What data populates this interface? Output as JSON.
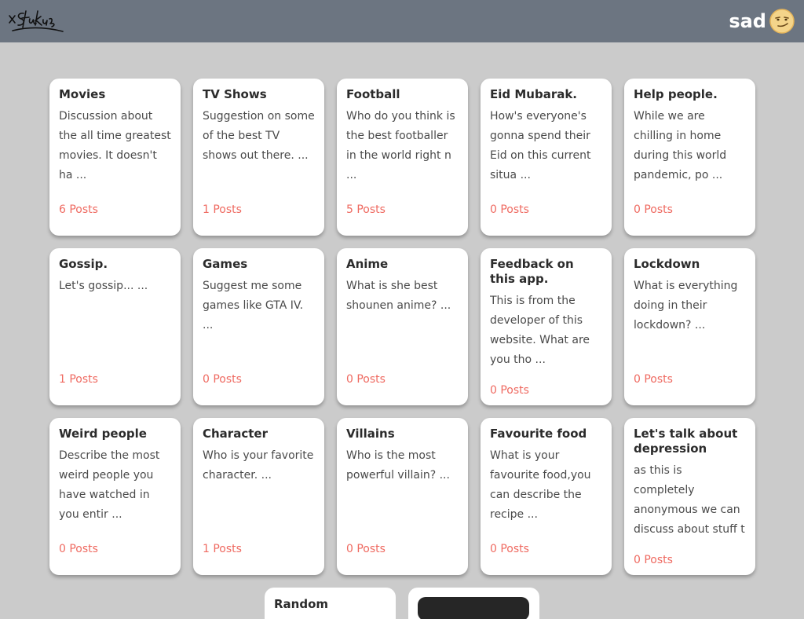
{
  "header": {
    "logo_text": "xStalkers",
    "username": "sad",
    "avatar_icon": "smirk-face-icon",
    "background_color": "#6c7581"
  },
  "colors": {
    "posts_accent": "#ef6a61",
    "page_background": "#cbcbcb"
  },
  "topics": [
    {
      "title": "Movies",
      "description": "Discussion about the all time greatest movies. It doesn't ha ...",
      "posts": "6 Posts"
    },
    {
      "title": "TV Shows",
      "description": "Suggestion on some of the best TV shows out there. ...",
      "posts": "1 Posts"
    },
    {
      "title": "Football",
      "description": "Who do you think is the best footballer in the world right n ...",
      "posts": "5 Posts"
    },
    {
      "title": "Eid Mubarak.",
      "description": "How's everyone's gonna spend their Eid on this current situa ...",
      "posts": "0 Posts"
    },
    {
      "title": "Help people.",
      "description": "While we are chilling in home during this world pandemic, po ...",
      "posts": "0 Posts"
    },
    {
      "title": "Gossip.",
      "description": "Let's gossip... ...",
      "posts": "1 Posts"
    },
    {
      "title": "Games",
      "description": "Suggest me some games like GTA IV. ...",
      "posts": "0 Posts"
    },
    {
      "title": "Anime",
      "description": "What is she best shounen anime? ...",
      "posts": "0 Posts"
    },
    {
      "title": "Feedback on this app.",
      "description": "This is from the developer of this website. What are you tho ...",
      "posts": "0 Posts"
    },
    {
      "title": "Lockdown",
      "description": "What is everything doing in their lockdown? ...",
      "posts": "0 Posts"
    },
    {
      "title": "Weird people",
      "description": "Describe the most weird people you have watched in you entir ...",
      "posts": "0 Posts"
    },
    {
      "title": "Character",
      "description": "Who is your favorite character. ...",
      "posts": "1 Posts"
    },
    {
      "title": "Villains",
      "description": "Who is the most powerful villain? ...",
      "posts": "0 Posts"
    },
    {
      "title": "Favourite food",
      "description": "What is your favourite food,you can describe the recipe ...",
      "posts": "0 Posts"
    },
    {
      "title": "Let's talk about depression",
      "description": "as this is completely anonymous we can discuss about stuff t ...",
      "posts": "0 Posts"
    }
  ],
  "bottom": {
    "random_title": "Random"
  }
}
